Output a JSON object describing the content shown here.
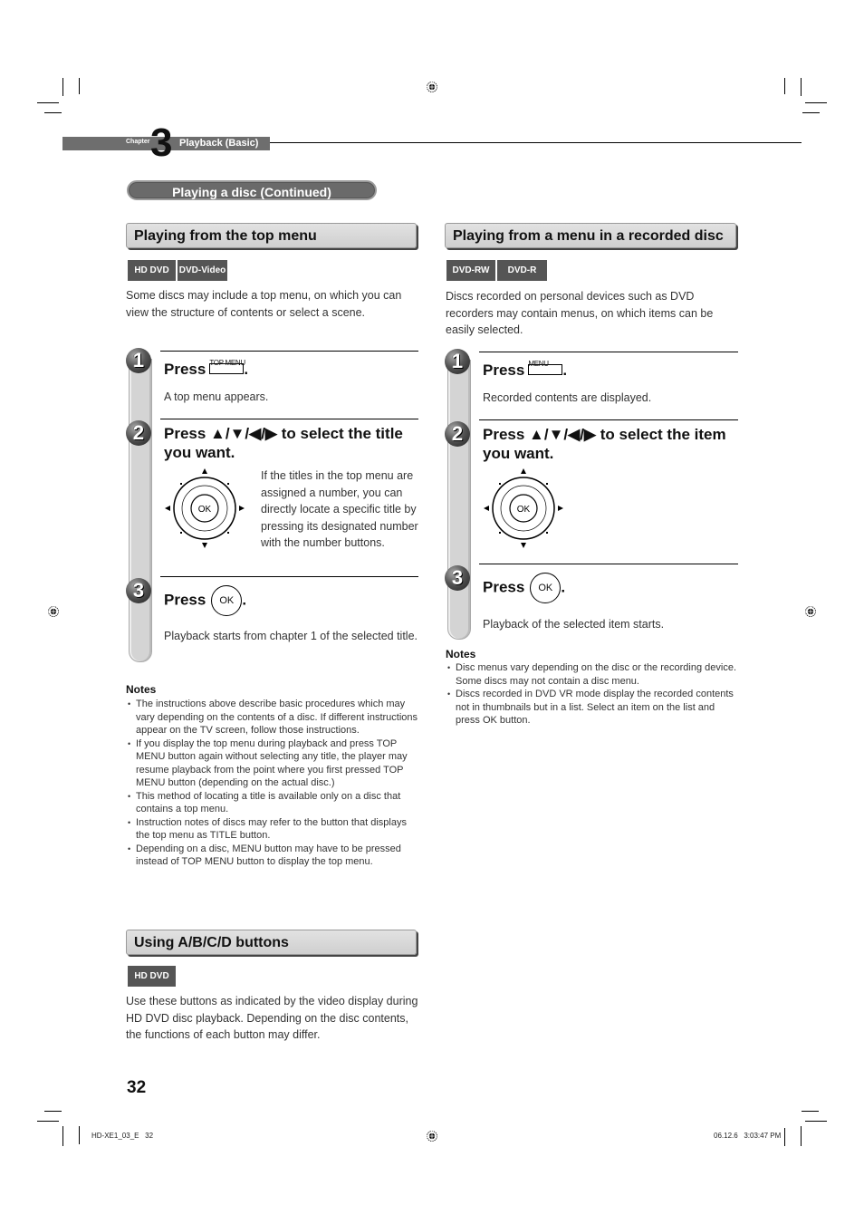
{
  "chapter": {
    "word": "Chapter",
    "number": "3",
    "title": "Playback (Basic)"
  },
  "pill_title": "Playing a disc (Continued)",
  "top_menu_section": {
    "heading": "Playing from the top menu",
    "badges": [
      "HD DVD",
      "DVD-Video"
    ],
    "intro": "Some discs may include a top menu, on which you can view the structure of contents or select a scene.",
    "steps": [
      {
        "num": "1",
        "title_prefix": "Press",
        "button_label": "TOP MENU",
        "title_suffix": ".",
        "desc": "A top menu appears."
      },
      {
        "num": "2",
        "title": "Press ▲/▼/◀/▶ to select the title you want.",
        "desc": "If the titles in the top menu are assigned a number, you can directly locate a specific title by pressing its designated number with the number buttons.",
        "dpad_center": "OK"
      },
      {
        "num": "3",
        "title_prefix": "Press",
        "button_label": "OK",
        "title_suffix": ".",
        "desc": "Playback starts from chapter 1 of the selected title."
      }
    ],
    "notes_title": "Notes",
    "notes": [
      "The instructions above describe basic procedures which may vary depending on the contents of a disc. If different instructions appear on the TV screen, follow those instructions.",
      "If you display the top menu during playback and press TOP MENU button again without selecting any title, the player may resume playback from the point where you first pressed TOP MENU button (depending on the actual disc.)",
      "This method of locating a title is available only on a disc that contains a top menu.",
      "Instruction notes of discs may refer to the button that displays the top menu as TITLE button.",
      "Depending on a disc, MENU button may have to be pressed instead of TOP MENU button to display the top menu."
    ]
  },
  "abcd_section": {
    "heading": "Using A/B/C/D buttons",
    "badges": [
      "HD DVD"
    ],
    "body": "Use these buttons as indicated by the video display during HD DVD disc playback. Depending on the disc contents, the functions of each button may differ."
  },
  "recorded_section": {
    "heading": "Playing from a menu in a recorded disc",
    "badges": [
      "DVD-RW",
      "DVD-R"
    ],
    "intro": "Discs recorded on personal devices such as DVD recorders may contain menus, on which items can be easily selected.",
    "steps": [
      {
        "num": "1",
        "title_prefix": "Press",
        "button_label": "MENU",
        "title_suffix": ".",
        "desc": "Recorded contents are displayed."
      },
      {
        "num": "2",
        "title": "Press ▲/▼/◀/▶ to select the item you want.",
        "dpad_center": "OK"
      },
      {
        "num": "3",
        "title_prefix": "Press",
        "button_label": "OK",
        "title_suffix": ".",
        "desc": "Playback of the selected item starts."
      }
    ],
    "notes_title": "Notes",
    "notes": [
      "Disc menus vary depending on the disc or the recording device. Some discs may not contain a disc menu.",
      "Discs recorded in DVD VR mode display the recorded contents not in thumbnails but in a list. Select an item on the list and press OK button."
    ]
  },
  "footer": {
    "page_number": "32",
    "slug_left": "HD-XE1_03_E   32",
    "slug_right": "06.12.6   3:03:47 PM"
  }
}
